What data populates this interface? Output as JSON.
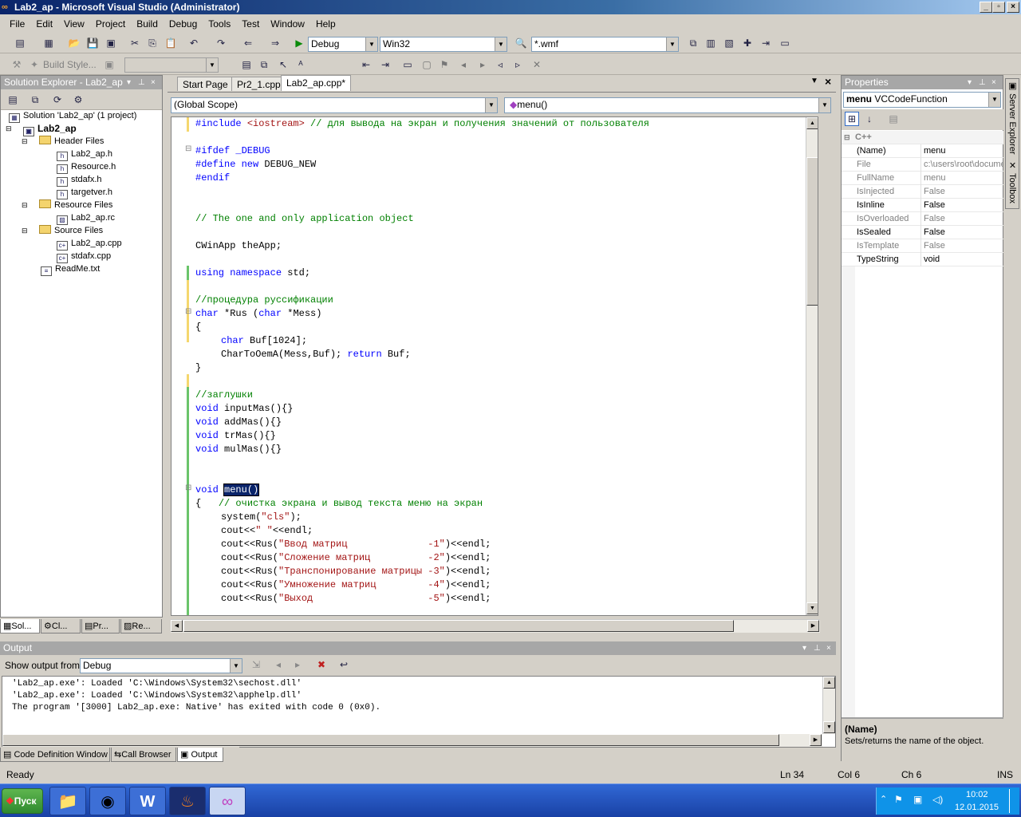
{
  "window": {
    "title": "Lab2_ap - Microsoft Visual Studio (Administrator)"
  },
  "menu": [
    "File",
    "Edit",
    "View",
    "Project",
    "Build",
    "Debug",
    "Tools",
    "Test",
    "Window",
    "Help"
  ],
  "toolbar": {
    "config": "Debug",
    "platform": "Win32",
    "find": "*.wmf",
    "build_style": "Build Style..."
  },
  "solution_explorer": {
    "title": "Solution Explorer - Lab2_ap",
    "solution": "Solution 'Lab2_ap' (1 project)",
    "project": "Lab2_ap",
    "header_folder": "Header Files",
    "headers": [
      "Lab2_ap.h",
      "Resource.h",
      "stdafx.h",
      "targetver.h"
    ],
    "resource_folder": "Resource Files",
    "resources": [
      "Lab2_ap.rc"
    ],
    "source_folder": "Source Files",
    "sources": [
      "Lab2_ap.cpp",
      "stdafx.cpp"
    ],
    "readme": "ReadMe.txt",
    "tabs": [
      "Sol...",
      "Cl...",
      "Pr...",
      "Re..."
    ]
  },
  "editor": {
    "tabs": [
      "Start Page",
      "Pr2_1.cpp",
      "Lab2_ap.cpp*"
    ],
    "scope": "(Global Scope)",
    "member": "menu()"
  },
  "code": {
    "l1_kw": "#include ",
    "l1_str": "<iostream>",
    "l1_cm": " // для вывода на экран и получения значений от пользователя",
    "l2": "#ifdef _DEBUG",
    "l3_a": "#define ",
    "l3_kw": "new",
    "l3_b": " DEBUG_NEW",
    "l4": "#endif",
    "l5": "// The one and only application object",
    "l6": "CWinApp theApp;",
    "l7_kw": "using namespace",
    "l7_b": " std;",
    "l8": "//процедура руссификации",
    "l9_kw": "char",
    "l9_b": " *Rus (",
    "l9_kw2": "char",
    "l9_c": " *Mess)",
    "l10": "{",
    "l11_kw": "char",
    "l11_b": " Buf[1024];",
    "l12_a": "CharToOemA(Mess,Buf); ",
    "l12_kw": "return",
    "l12_b": " Buf;",
    "l13": "}",
    "l14": "//заглушки",
    "l15_b": " inputMas(){}",
    "l16_b": " addMas(){}",
    "l17_b": " trMas(){}",
    "l18_b": " mulMas(){}",
    "void": "void",
    "l19_sel": "menu()",
    "l20_a": "{   ",
    "l20_cm": "// очистка экрана и вывод текста меню на экран",
    "l21_a": "system(",
    "l21_str": "\"cls\"",
    "l21_b": ");",
    "l22_a": "cout<<",
    "l22_str": "\" \"",
    "l22_b": "<<endl;",
    "rus_pre": "cout<<Rus(",
    "rus_post": ")<<endl;",
    "l23_str": "\"Ввод матриц              -1\"",
    "l24_str": "\"Сложение матриц          -2\"",
    "l25_str": "\"Транспонирование матрицы -3\"",
    "l26_str": "\"Умножение матриц         -4\"",
    "l27_str": "\"Выход                    -5\""
  },
  "output": {
    "title": "Output",
    "show_label": "Show output from:",
    "source": "Debug",
    "lines": [
      "'Lab2_ap.exe': Loaded 'C:\\Windows\\System32\\sechost.dll'",
      "'Lab2_ap.exe': Loaded 'C:\\Windows\\System32\\apphelp.dll'",
      "The program '[3000] Lab2_ap.exe: Native' has exited with code 0 (0x0)."
    ],
    "tabs": [
      "Code Definition Window",
      "Call Browser",
      "Output"
    ]
  },
  "properties": {
    "title": "Properties",
    "object_name": "menu",
    "object_type": "VCCodeFunction",
    "category": "C++",
    "rows": [
      {
        "name": "(Name)",
        "value": "menu"
      },
      {
        "name": "File",
        "value": "c:\\users\\root\\docume"
      },
      {
        "name": "FullName",
        "value": "menu"
      },
      {
        "name": "IsInjected",
        "value": "False"
      },
      {
        "name": "IsInline",
        "value": "False"
      },
      {
        "name": "IsOverloaded",
        "value": "False"
      },
      {
        "name": "IsSealed",
        "value": "False"
      },
      {
        "name": "IsTemplate",
        "value": "False"
      },
      {
        "name": "TypeString",
        "value": "void"
      }
    ],
    "desc_title": "(Name)",
    "desc_text": "Sets/returns the name of the object."
  },
  "side_tabs": [
    "Server Explorer",
    "Toolbox"
  ],
  "status": {
    "ready": "Ready",
    "ln": "Ln 34",
    "col": "Col 6",
    "ch": "Ch 6",
    "ins": "INS"
  },
  "taskbar": {
    "start": "Пуск",
    "time": "10:02",
    "date": "12.01.2015"
  }
}
